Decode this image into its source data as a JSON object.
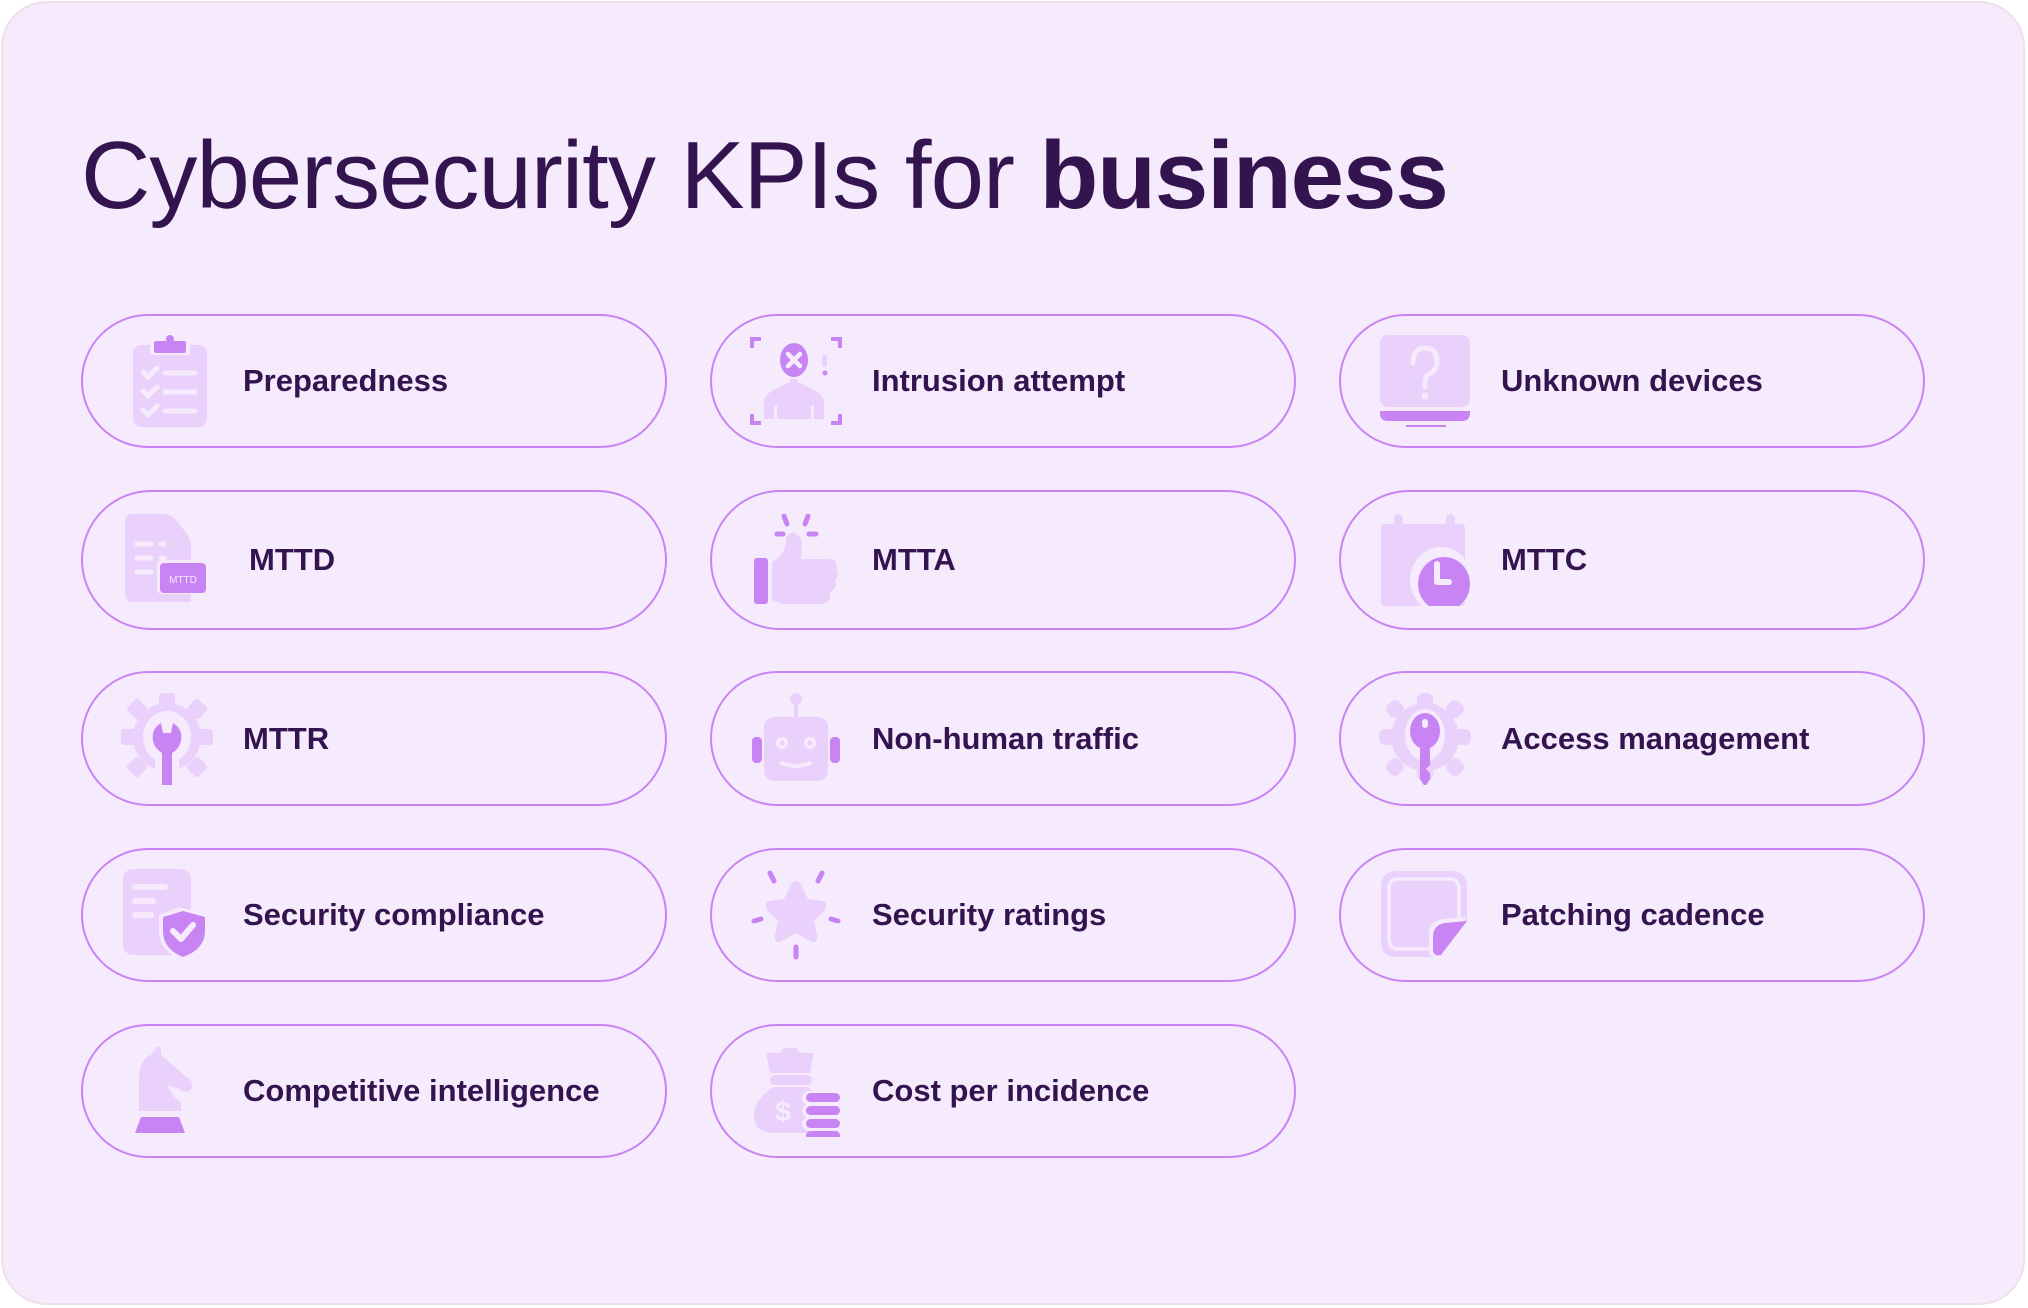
{
  "title": {
    "regular": "Cybersecurity KPIs for ",
    "bold": "business"
  },
  "colors": {
    "background": "#f5ebfd",
    "text": "#33144f",
    "accent": "#c984f4",
    "icon_light": "#e9d1fb",
    "pill_border": "#c984f4"
  },
  "kpis": [
    {
      "label": "Preparedness",
      "icon": "clipboard-checklist-icon"
    },
    {
      "label": "Intrusion attempt",
      "icon": "intruder-face-scan-icon"
    },
    {
      "label": "Unknown devices",
      "icon": "monitor-question-icon"
    },
    {
      "label": "MTTD",
      "icon": "document-mttd-icon",
      "icon_text": "MTTD"
    },
    {
      "label": "MTTA",
      "icon": "thumbs-up-icon"
    },
    {
      "label": "MTTC",
      "icon": "calendar-clock-icon"
    },
    {
      "label": "MTTR",
      "icon": "gear-wrench-icon"
    },
    {
      "label": "Non-human traffic",
      "icon": "robot-icon"
    },
    {
      "label": "Access management",
      "icon": "gear-key-icon"
    },
    {
      "label": "Security compliance",
      "icon": "document-shield-icon"
    },
    {
      "label": "Security ratings",
      "icon": "star-sparkle-icon"
    },
    {
      "label": "Patching cadence",
      "icon": "sticky-note-icon"
    },
    {
      "label": "Competitive intelligence",
      "icon": "chess-knight-icon"
    },
    {
      "label": "Cost per incidence",
      "icon": "money-bag-coins-icon"
    }
  ]
}
